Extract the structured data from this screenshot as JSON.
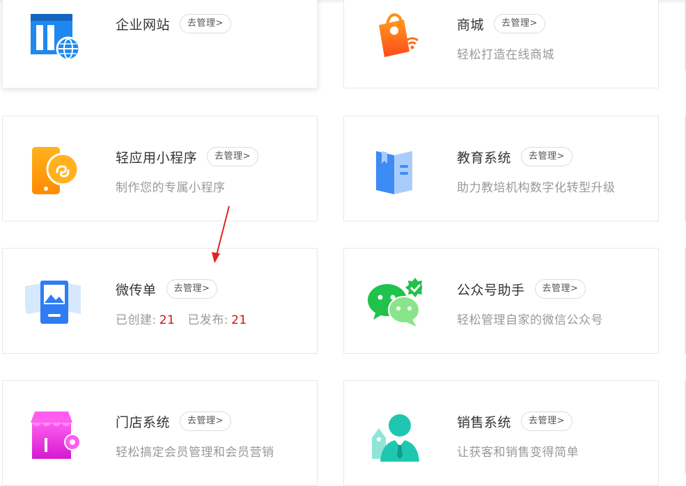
{
  "manage_label": "去管理>",
  "cards": [
    {
      "id": "website",
      "title": "企业网站",
      "desc": ""
    },
    {
      "id": "mall",
      "title": "商城",
      "desc": "轻松打造在线商城"
    },
    {
      "id": "miniapp",
      "title": "轻应用小程序",
      "desc": "制作您的专属小程序"
    },
    {
      "id": "education",
      "title": "教育系统",
      "desc": "助力教培机构数字化转型升级"
    },
    {
      "id": "flyer",
      "title": "微传单",
      "created_label": "已创建:",
      "created_value": "21",
      "published_label": "已发布:",
      "published_value": "21"
    },
    {
      "id": "wechat",
      "title": "公众号助手",
      "desc": "轻松管理自家的微信公众号"
    },
    {
      "id": "store",
      "title": "门店系统",
      "desc": "轻松搞定会员管理和会员营销"
    },
    {
      "id": "sales",
      "title": "销售系统",
      "desc": "让获客和销售变得简单"
    }
  ],
  "icons": {
    "website": "website-globe-icon",
    "mall": "shopping-bag-wifi-icon",
    "miniapp": "mini-program-phone-icon",
    "education": "book-icon",
    "flyer": "flyer-image-icon",
    "wechat": "wechat-icon",
    "store": "store-gear-icon",
    "sales": "salesperson-icon"
  },
  "colors": {
    "accent_red": "#cc1111",
    "annotation_arrow": "#e02424"
  }
}
